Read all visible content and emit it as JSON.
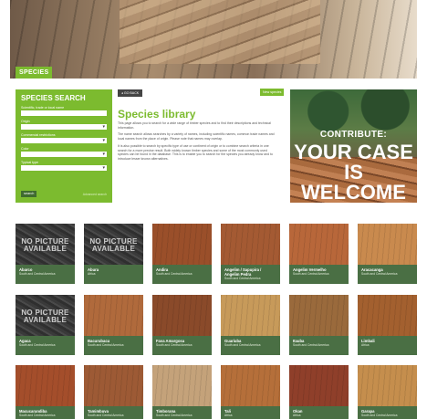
{
  "hero": {
    "section_label": "SPECIES"
  },
  "search": {
    "title": "SPECIES SEARCH",
    "fields": [
      {
        "label": "Scientific, trade or local name",
        "value": ""
      },
      {
        "label": "Origin",
        "value": ""
      },
      {
        "label": "Commercial restrictions",
        "value": ""
      },
      {
        "label": "Color",
        "value": ""
      },
      {
        "label": "Typical type",
        "value": ""
      }
    ],
    "submit_label": "search",
    "more_label": "Advanced search"
  },
  "toolbar": {
    "back_label": "GO BACK",
    "new_label": "New species"
  },
  "library": {
    "title": "Species library",
    "p1": "This page allows you to search for a wide range of timber species and to find their descriptions and technical information.",
    "p2": "The name search allows searches by a variety of names, including scientific names, common trade names and local names from the place of origin. Please note that names may overlap.",
    "p3": "It is also possible to search by specific type of use or continent of origin or to combine search criteria in one search for a more precise result. Both widely known timber species and some of the most commonly used species can be found in the database. This is to enable you to search for the species you already know and to introduce lesser known alternatives."
  },
  "contribute": {
    "line1": "CONTRIBUTE:",
    "line2": "YOUR CASE",
    "line3": "IS WELCOME"
  },
  "species": [
    {
      "name": "Abarco",
      "region": "South and Central America",
      "image": "no-picture",
      "color": ""
    },
    {
      "name": "Abura",
      "region": "Africa",
      "image": "no-picture",
      "color": ""
    },
    {
      "name": "Andira",
      "region": "South and Central America",
      "image": "wood",
      "color": "#9a4f2a"
    },
    {
      "name": "Angelim / Sapupira / Angelim Pedra",
      "region": "South and Central America",
      "image": "wood",
      "color": "#a45a33"
    },
    {
      "name": "Angelim Vermelho",
      "region": "South and Central America",
      "image": "wood",
      "color": "#b8673a"
    },
    {
      "name": "Aracacanga",
      "region": "South and Central America",
      "image": "wood",
      "color": "#c98a4e"
    },
    {
      "name": "Agaca",
      "region": "South and Central America",
      "image": "no-picture",
      "color": ""
    },
    {
      "name": "Bacurubacu",
      "region": "South and Central America",
      "image": "wood",
      "color": "#b06a3c"
    },
    {
      "name": "Fava Amargosa",
      "region": "South and Central America",
      "image": "wood",
      "color": "#8a4a2a"
    },
    {
      "name": "Guariuba",
      "region": "South and Central America",
      "image": "wood",
      "color": "#c79a5a"
    },
    {
      "name": "Itauba",
      "region": "South and Central America",
      "image": "wood",
      "color": "#9a6a3c"
    },
    {
      "name": "Limbali",
      "region": "Africa",
      "image": "wood",
      "color": "#a3602f"
    },
    {
      "name": "Macucarandiba",
      "region": "South and Central America",
      "image": "wood",
      "color": "#a44e2b"
    },
    {
      "name": "Tamimbuva",
      "region": "South and Central America",
      "image": "wood",
      "color": "#9d5a35"
    },
    {
      "name": "Timborana",
      "region": "South and Central America",
      "image": "wood",
      "color": "#c4a27a"
    },
    {
      "name": "Tali",
      "region": "Africa",
      "image": "wood",
      "color": "#b56f3a"
    },
    {
      "name": "Okan",
      "region": "Africa",
      "image": "wood",
      "color": "#8f3f2a"
    },
    {
      "name": "Garapa",
      "region": "South and Central America",
      "image": "wood",
      "color": "#c58e4d"
    }
  ],
  "no_picture_text": [
    "NO PICTURE",
    "AVAILABLE"
  ]
}
